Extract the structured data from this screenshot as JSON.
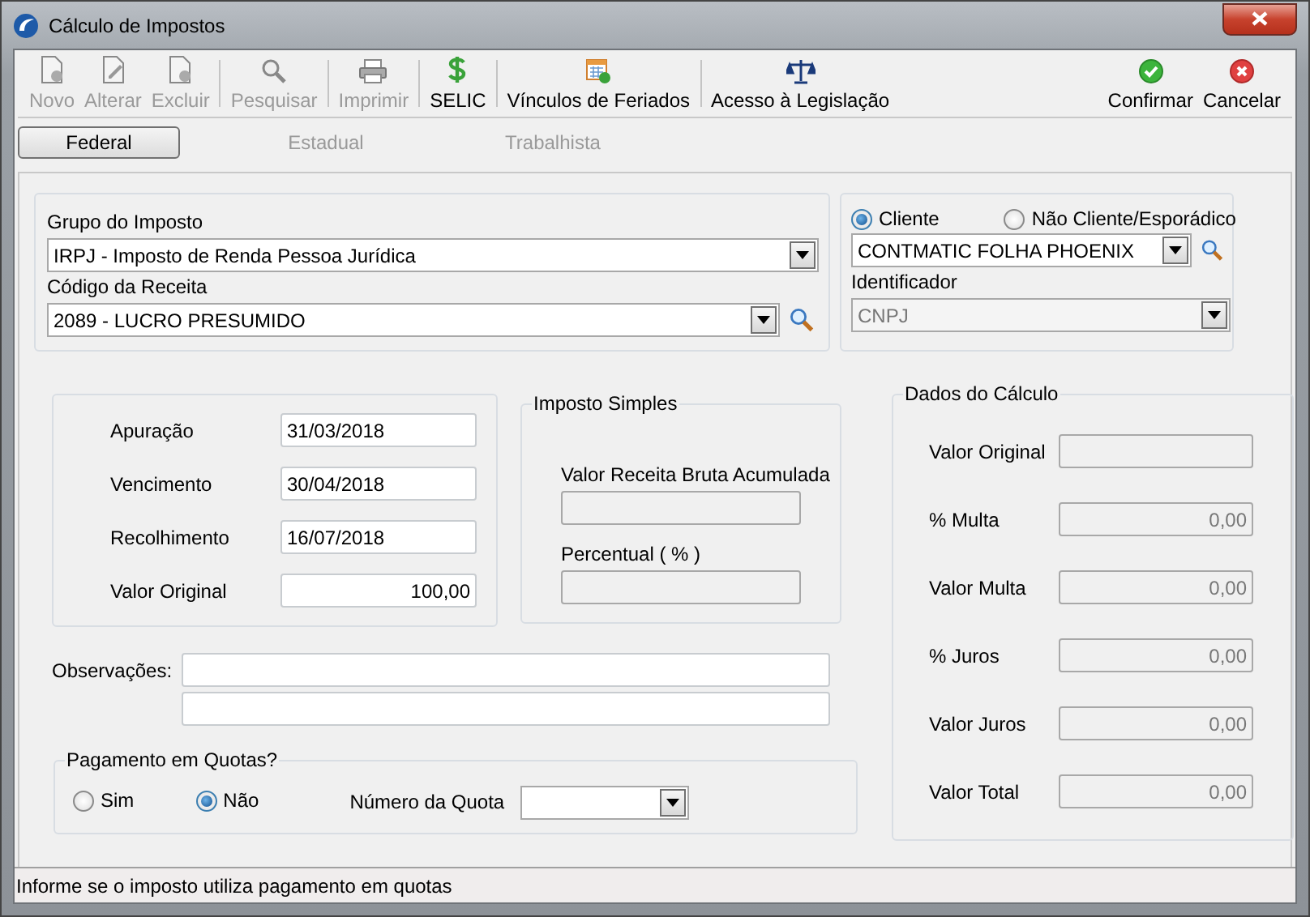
{
  "window": {
    "title": "Cálculo de Impostos"
  },
  "toolbar": [
    {
      "label": "Novo",
      "kind": "new",
      "disabled": true,
      "separator_after": false
    },
    {
      "label": "Alterar",
      "kind": "edit",
      "disabled": true,
      "separator_after": false
    },
    {
      "label": "Excluir",
      "kind": "delete",
      "disabled": true,
      "separator_after": true
    },
    {
      "label": "Pesquisar",
      "kind": "search",
      "disabled": true,
      "separator_after": true
    },
    {
      "label": "Imprimir",
      "kind": "print",
      "disabled": true,
      "separator_after": true
    },
    {
      "label": "SELIC",
      "kind": "dollar",
      "disabled": false,
      "separator_after": true
    },
    {
      "label": "Vínculos de Feriados",
      "kind": "calendar",
      "disabled": false,
      "separator_after": true
    },
    {
      "label": "Acesso à Legislação",
      "kind": "scales",
      "disabled": false,
      "separator_after": false
    }
  ],
  "actions": [
    {
      "label": "Confirmar",
      "kind": "confirm"
    },
    {
      "label": "Cancelar",
      "kind": "cancel"
    }
  ],
  "tabs": [
    {
      "label": "Federal",
      "selected": true
    },
    {
      "label": "Estadual",
      "selected": false
    },
    {
      "label": "Trabalhista",
      "selected": false
    }
  ],
  "tax_group": {
    "label": "Grupo do Imposto",
    "value": "IRPJ - Imposto de Renda Pessoa Jurídica"
  },
  "revenue_code": {
    "label": "Código da Receita",
    "value": "2089 - LUCRO PRESUMIDO"
  },
  "client": {
    "options": [
      {
        "label": "Cliente",
        "selected": true
      },
      {
        "label": "Não Cliente/Esporádico",
        "selected": false
      }
    ],
    "value": "CONTMATIC FOLHA PHOENIX",
    "identifier": {
      "label": "Identificador",
      "value": "CNPJ",
      "disabled": true
    }
  },
  "dates": [
    {
      "label": "Apuração",
      "value": "31/03/2018",
      "kind": "date"
    },
    {
      "label": "Vencimento",
      "value": "30/04/2018",
      "kind": "date"
    },
    {
      "label": "Recolhimento",
      "value": "16/07/2018",
      "kind": "date"
    },
    {
      "label": "Valor Original",
      "value": "100,00",
      "kind": "amount"
    }
  ],
  "simples": {
    "title": "Imposto Simples",
    "fields": [
      {
        "label": "Valor Receita Bruta Acumulada"
      },
      {
        "label": "Percentual ( % )"
      }
    ]
  },
  "calculation": {
    "title": "Dados do Cálculo",
    "fields": [
      {
        "label": "Valor Original"
      },
      {
        "label": "% Multa",
        "value": "0,00"
      },
      {
        "label": "Valor Multa",
        "value": "0,00"
      },
      {
        "label": "% Juros",
        "value": "0,00"
      },
      {
        "label": "Valor Juros",
        "value": "0,00"
      },
      {
        "label": "Valor Total",
        "value": "0,00"
      }
    ]
  },
  "observations": {
    "label": "Observações:"
  },
  "quotas": {
    "title": "Pagamento em Quotas?",
    "options": [
      {
        "label": "Sim",
        "selected": false
      },
      {
        "label": "Não",
        "selected": true
      }
    ],
    "number_label": "Número da Quota"
  },
  "status_bar": "Informe se o imposto utiliza pagamento em quotas"
}
